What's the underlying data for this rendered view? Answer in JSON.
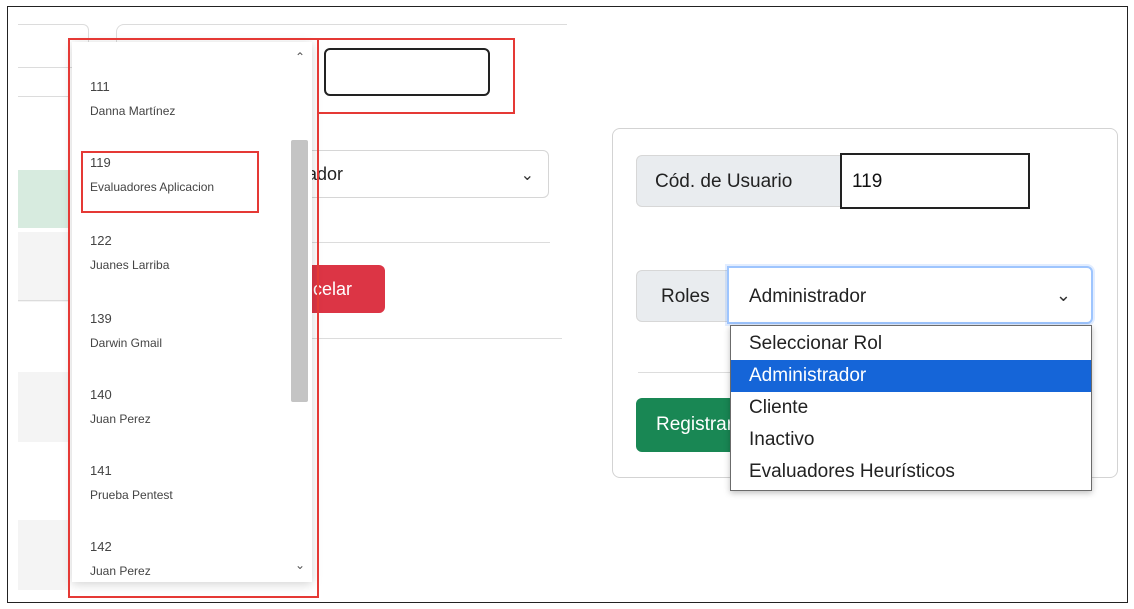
{
  "left_list": {
    "items": [
      {
        "code": "111",
        "name": "Danna Martínez"
      },
      {
        "code": "119",
        "name": "Evaluadores Aplicacion"
      },
      {
        "code": "122",
        "name": "Juanes Larriba"
      },
      {
        "code": "139",
        "name": "Darwin Gmail"
      },
      {
        "code": "140",
        "name": "Juan Perez"
      },
      {
        "code": "141",
        "name": "Prueba Pentest"
      },
      {
        "code": "142",
        "name": "Juan Perez"
      }
    ],
    "up_arrow": "⌃",
    "down_arrow": "⌄"
  },
  "left_bg": {
    "select_text": "trador",
    "cancel_label": "ncelar"
  },
  "form": {
    "user_code_label": "Cód. de Usuario",
    "user_code_value": "119",
    "roles_label": "Roles",
    "roles_selected": "Administrador",
    "register_label": "Registrar",
    "role_options": [
      {
        "label": "Seleccionar Rol",
        "selected": false
      },
      {
        "label": "Administrador",
        "selected": true
      },
      {
        "label": "Cliente",
        "selected": false
      },
      {
        "label": "Inactivo",
        "selected": false
      },
      {
        "label": "Evaluadores Heurísticos",
        "selected": false
      }
    ]
  },
  "icons": {
    "chevron": "⌄"
  },
  "colors": {
    "highlight_red": "#e53935",
    "option_selected": "#1565d8",
    "register_green": "#198754",
    "cancel_red": "#dc3545"
  }
}
